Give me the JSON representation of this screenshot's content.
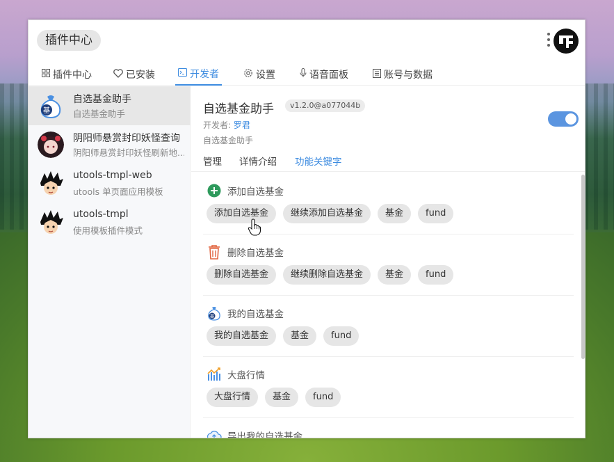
{
  "window": {
    "title": "插件中心"
  },
  "nav_tabs": [
    {
      "label": "插件中心",
      "icon": "grid-icon"
    },
    {
      "label": "已安装",
      "icon": "heart-icon"
    },
    {
      "label": "开发者",
      "icon": "terminal-icon",
      "active": true
    },
    {
      "label": "设置",
      "icon": "gear-icon"
    },
    {
      "label": "语音面板",
      "icon": "microphone-icon"
    },
    {
      "label": "账号与数据",
      "icon": "ledger-icon"
    }
  ],
  "plugins": [
    {
      "title": "自选基金助手",
      "desc": "自选基金助手",
      "avatar": "fund-bag-avatar",
      "active": true
    },
    {
      "title": "阴阳师悬赏封印妖怪查询",
      "desc": "阴阳师悬赏封印妖怪刷新地...",
      "avatar": "anime-girl-avatar"
    },
    {
      "title": "utools-tmpl-web",
      "desc": "utools 单页面应用模板",
      "avatar": "goku-avatar"
    },
    {
      "title": "utools-tmpl",
      "desc": "使用模板插件模式",
      "avatar": "goku-avatar"
    }
  ],
  "detail": {
    "name": "自选基金助手",
    "version": "v1.2.0@a077044b",
    "developer_label": "开发者:",
    "developer_name": "罗君",
    "description": "自选基金助手",
    "enabled": true,
    "subtabs": [
      {
        "label": "管理"
      },
      {
        "label": "详情介绍"
      },
      {
        "label": "功能关键字",
        "active": true
      }
    ]
  },
  "features": [
    {
      "title": "添加自选基金",
      "icon": "plus-circle-icon",
      "commands": [
        "添加自选基金",
        "继续添加自选基金",
        "基金",
        "fund"
      ]
    },
    {
      "title": "删除自选基金",
      "icon": "trash-icon",
      "commands": [
        "删除自选基金",
        "继续删除自选基金",
        "基金",
        "fund"
      ]
    },
    {
      "title": "我的自选基金",
      "icon": "fund-bag-icon",
      "commands": [
        "我的自选基金",
        "基金",
        "fund"
      ]
    },
    {
      "title": "大盘行情",
      "icon": "market-chart-icon",
      "commands": [
        "大盘行情",
        "基金",
        "fund"
      ]
    },
    {
      "title": "导出我的自选基金",
      "icon": "cloud-export-icon",
      "commands": []
    }
  ],
  "colors": {
    "accent": "#3c8be0",
    "add_green": "#2e9a5c",
    "trash_red": "#e2643f"
  }
}
